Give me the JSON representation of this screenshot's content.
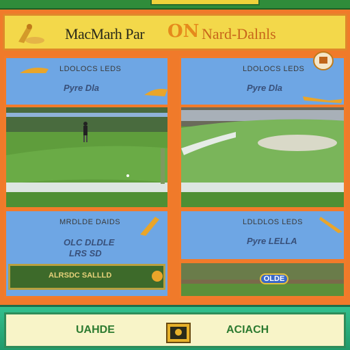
{
  "header": {
    "title": "MacMarh Par",
    "title_mid": "ON",
    "title_right": "Nard-Dalnls"
  },
  "panels": {
    "top_left": {
      "label": "LDOLOCS LEDS",
      "sub": "Pyre Dla"
    },
    "top_right": {
      "label": "LDOLOCS LEDS",
      "sub": "Pyre Dla"
    },
    "mid_left": {
      "label": "MRDLDE DAIDS",
      "sub1": "OLC DLDLE",
      "sub2": "LRS SD",
      "banner": "ALRSDC SALLLD"
    },
    "mid_right": {
      "label": "LDLDLOS LEDS",
      "sub": "Pyre LELLA",
      "score": "OLDE"
    }
  },
  "footer": {
    "left_button": "UAHDE",
    "right_button": "ACIACH"
  },
  "colors": {
    "frame_orange": "#f27b2a",
    "panel_blue": "#6ea6e4",
    "header_yellow": "#f3d84a",
    "fairway_green": "#5f9d3c",
    "footer_green": "#2f9c6a"
  },
  "icons": [
    "golf-club-logo-icon",
    "golf-club-icon",
    "golfer-icon",
    "trophy-icon"
  ]
}
